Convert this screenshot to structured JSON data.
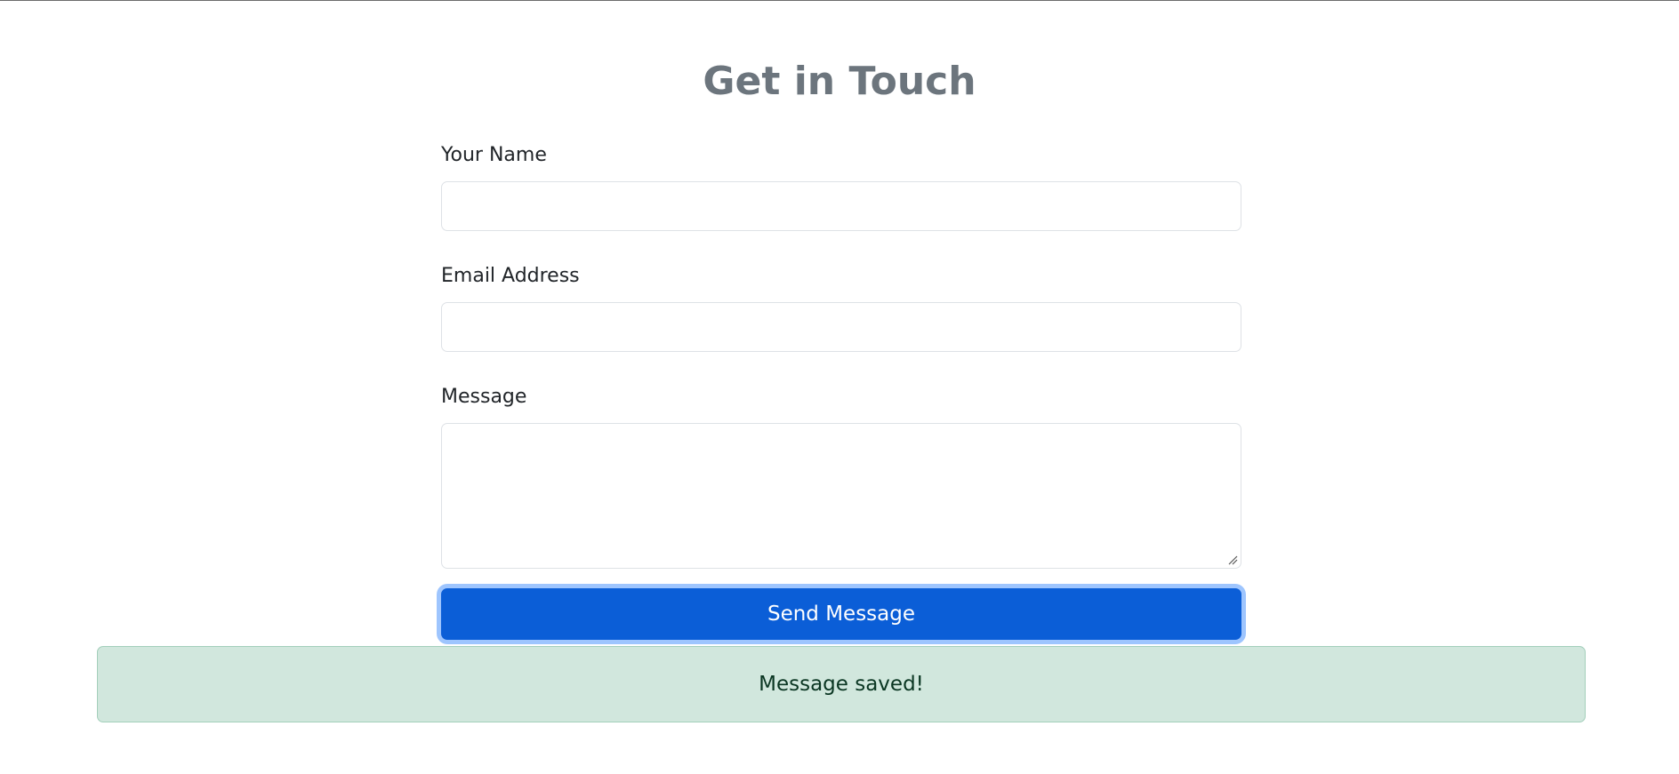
{
  "page": {
    "title": "Get in Touch"
  },
  "form": {
    "name": {
      "label": "Your Name",
      "value": "",
      "placeholder": ""
    },
    "email": {
      "label": "Email Address",
      "value": "",
      "placeholder": ""
    },
    "message": {
      "label": "Message",
      "value": "",
      "placeholder": ""
    },
    "submit_label": "Send Message"
  },
  "alert": {
    "text": "Message saved!",
    "type": "success"
  },
  "colors": {
    "title": "#6c757d",
    "button_bg": "#0b5ed7",
    "button_focus_ring": "#9ec5fe",
    "alert_bg": "#d1e7dd",
    "alert_border": "#a3cfbb",
    "alert_text": "#0a3622",
    "input_border": "#dee2e6"
  }
}
